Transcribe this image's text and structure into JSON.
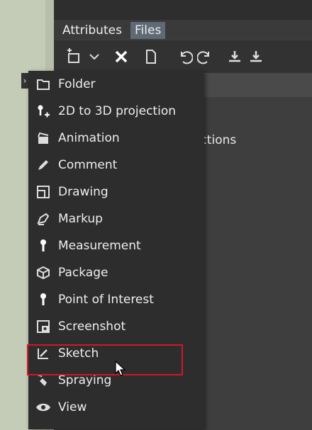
{
  "tabs": {
    "attributes": "Attributes",
    "files": "Files"
  },
  "panel": {
    "partial_text": "ections"
  },
  "menu": {
    "items": [
      {
        "label": "Folder",
        "icon": "folder-icon"
      },
      {
        "label": "2D to 3D projection",
        "icon": "pin-plus-icon"
      },
      {
        "label": "Animation",
        "icon": "clapperboard-icon"
      },
      {
        "label": "Comment",
        "icon": "pencil-icon"
      },
      {
        "label": "Drawing",
        "icon": "drawing-icon"
      },
      {
        "label": "Markup",
        "icon": "marker-icon"
      },
      {
        "label": "Measurement",
        "icon": "pin-icon"
      },
      {
        "label": "Package",
        "icon": "package-icon"
      },
      {
        "label": "Point of Interest",
        "icon": "pin-icon"
      },
      {
        "label": "Screenshot",
        "icon": "screenshot-icon"
      },
      {
        "label": "Sketch",
        "icon": "sketch-icon"
      },
      {
        "label": "Spraying",
        "icon": "spray-icon"
      },
      {
        "label": "View",
        "icon": "eye-icon"
      }
    ],
    "highlighted": "Sketch"
  },
  "colors": {
    "highlight_border": "#d4162a",
    "active_tab": "#5f6a75"
  }
}
